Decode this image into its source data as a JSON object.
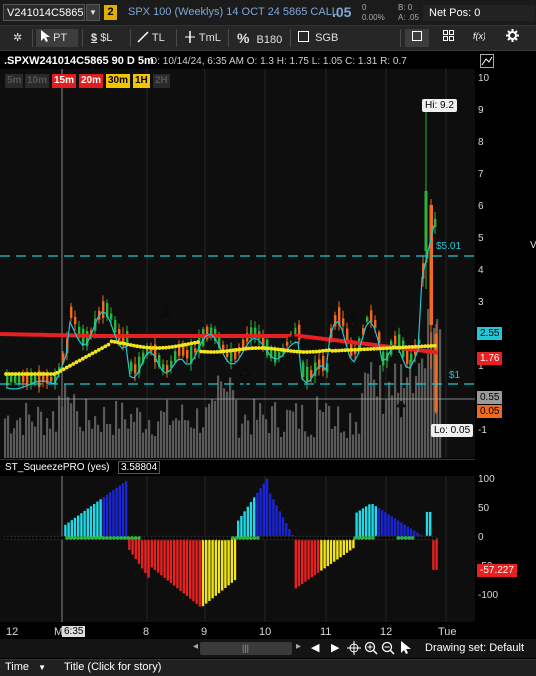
{
  "header": {
    "symbol": "V241014C5865",
    "link_badge": "2",
    "description": "SPX 100 (Weeklys) 14 OCT 24 5865 CALL",
    "last_price": ".05",
    "change": "0",
    "change_pct": "0.00%",
    "bid": "B: 0",
    "ask": "A: .05",
    "net_pos": "Net Pos: 0"
  },
  "toolbar": {
    "pin": "✲",
    "pointer_label": "PT",
    "price_label": "$L",
    "trendline_label": "TL",
    "timeline_label": "TmL",
    "fib_label": "B180",
    "sgb_label": "SGB"
  },
  "chart": {
    "title": ".SPXW241014C5865 90 D 5m",
    "info": "D: 10/14/24, 6:35 AM   O: 1.3   H: 1.75   L: 1.05   C: 1.31   R: 0.7",
    "timeframes": [
      {
        "label": "5m",
        "bg": "#2a2a2a",
        "fg": "#555"
      },
      {
        "label": "10m",
        "bg": "#2a2a2a",
        "fg": "#555"
      },
      {
        "label": "15m",
        "bg": "#e01e1e",
        "fg": "#fff"
      },
      {
        "label": "20m",
        "bg": "#e01e1e",
        "fg": "#fff"
      },
      {
        "label": "30m",
        "bg": "#f5c400",
        "fg": "#000"
      },
      {
        "label": "1H",
        "bg": "#f5c400",
        "fg": "#000"
      },
      {
        "label": "2H",
        "bg": "#2a2a2a",
        "fg": "#555"
      }
    ],
    "y_axis": [
      "10",
      "9",
      "8",
      "7",
      "6",
      "5",
      "4",
      "3",
      "2",
      "1",
      "0",
      "-1"
    ],
    "hi_label": "Hi: 9.2",
    "lo_label": "Lo: 0.05",
    "level_5_label": "$5.01",
    "level_1_label": "$1",
    "tags": {
      "cyan": "2.55",
      "red": "1.76",
      "gray": "0.55",
      "orange": "0.05"
    }
  },
  "squeeze": {
    "label": "ST_SqueezePRO (yes)",
    "value": "3.58804",
    "y_axis": [
      "100",
      "50",
      "0",
      "-50",
      "-100"
    ],
    "tag": "-57.227"
  },
  "x_axis": [
    "12",
    "M",
    "6:35",
    "8",
    "9",
    "10",
    "11",
    "12",
    "Tue"
  ],
  "status": {
    "time_label": "Time",
    "title_label": "Title (Click for story)",
    "drawing_set": "Drawing set: Default"
  },
  "colors": {
    "cyan": "#21c7d6",
    "red": "#e82020",
    "orange": "#f06a1f",
    "green": "#2fb33a",
    "yellow": "#f2e51c",
    "blue": "#1a24d8"
  }
}
